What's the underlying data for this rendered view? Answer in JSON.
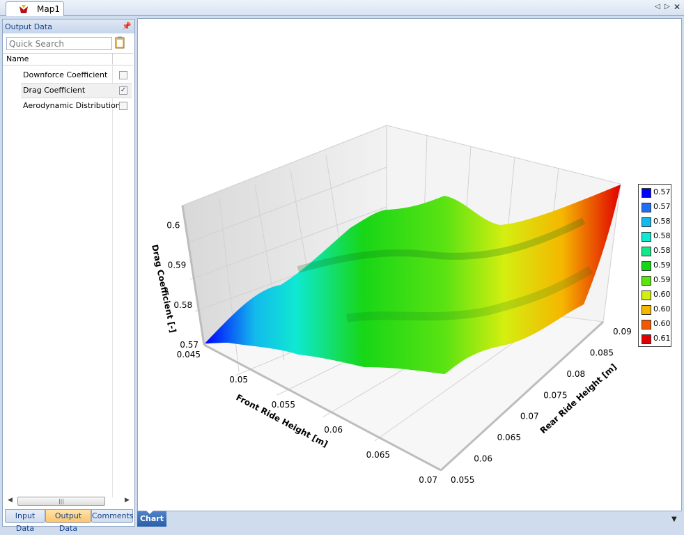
{
  "doc_tab": {
    "title": "Map1"
  },
  "panel": {
    "title": "Output Data",
    "search_placeholder": "Quick Search",
    "column_header": "Name",
    "items": [
      {
        "label": "Downforce Coefficient",
        "checked": false
      },
      {
        "label": "Drag Coefficient",
        "checked": true
      },
      {
        "label": "Aerodynamic Distribution",
        "checked": false
      }
    ],
    "check_glyph": "✓",
    "bottom_tabs": [
      "Input Data",
      "Output Data",
      "Comments"
    ]
  },
  "bottom_bar": {
    "chart_tab": "Chart"
  },
  "chart_data": {
    "type": "surface",
    "zlabel": "Drag Coefficient [-]",
    "xlabel": "Front Ride Height [m]",
    "ylabel": "Rear Ride Height [m]",
    "x_ticks": [
      "0.045",
      "0.05",
      "0.055",
      "0.06",
      "0.065",
      "0.07"
    ],
    "y_ticks": [
      "0.055",
      "0.06",
      "0.065",
      "0.07",
      "0.075",
      "0.08",
      "0.085",
      "0.09"
    ],
    "z_ticks": [
      "0.57",
      "0.58",
      "0.59",
      "0.6"
    ],
    "xlim": [
      0.045,
      0.07
    ],
    "ylim": [
      0.055,
      0.09
    ],
    "zlim": [
      0.57,
      0.605
    ],
    "legend": [
      {
        "label": "0.57",
        "color": "#0000ff"
      },
      {
        "label": "0.57",
        "color": "#1f6ff5"
      },
      {
        "label": "0.58",
        "color": "#13b9ec"
      },
      {
        "label": "0.58",
        "color": "#0fe9d2"
      },
      {
        "label": "0.58",
        "color": "#10e88a"
      },
      {
        "label": "0.59",
        "color": "#17d617"
      },
      {
        "label": "0.59",
        "color": "#5ce312"
      },
      {
        "label": "0.60",
        "color": "#d4ee10"
      },
      {
        "label": "0.60",
        "color": "#f5b600"
      },
      {
        "label": "0.60",
        "color": "#f25a00"
      },
      {
        "label": "0.61",
        "color": "#e00000"
      }
    ]
  },
  "colors": {
    "accent": "#15428b",
    "active_tab": "#fbc56e",
    "chart_tab": "#2a5eaa"
  }
}
